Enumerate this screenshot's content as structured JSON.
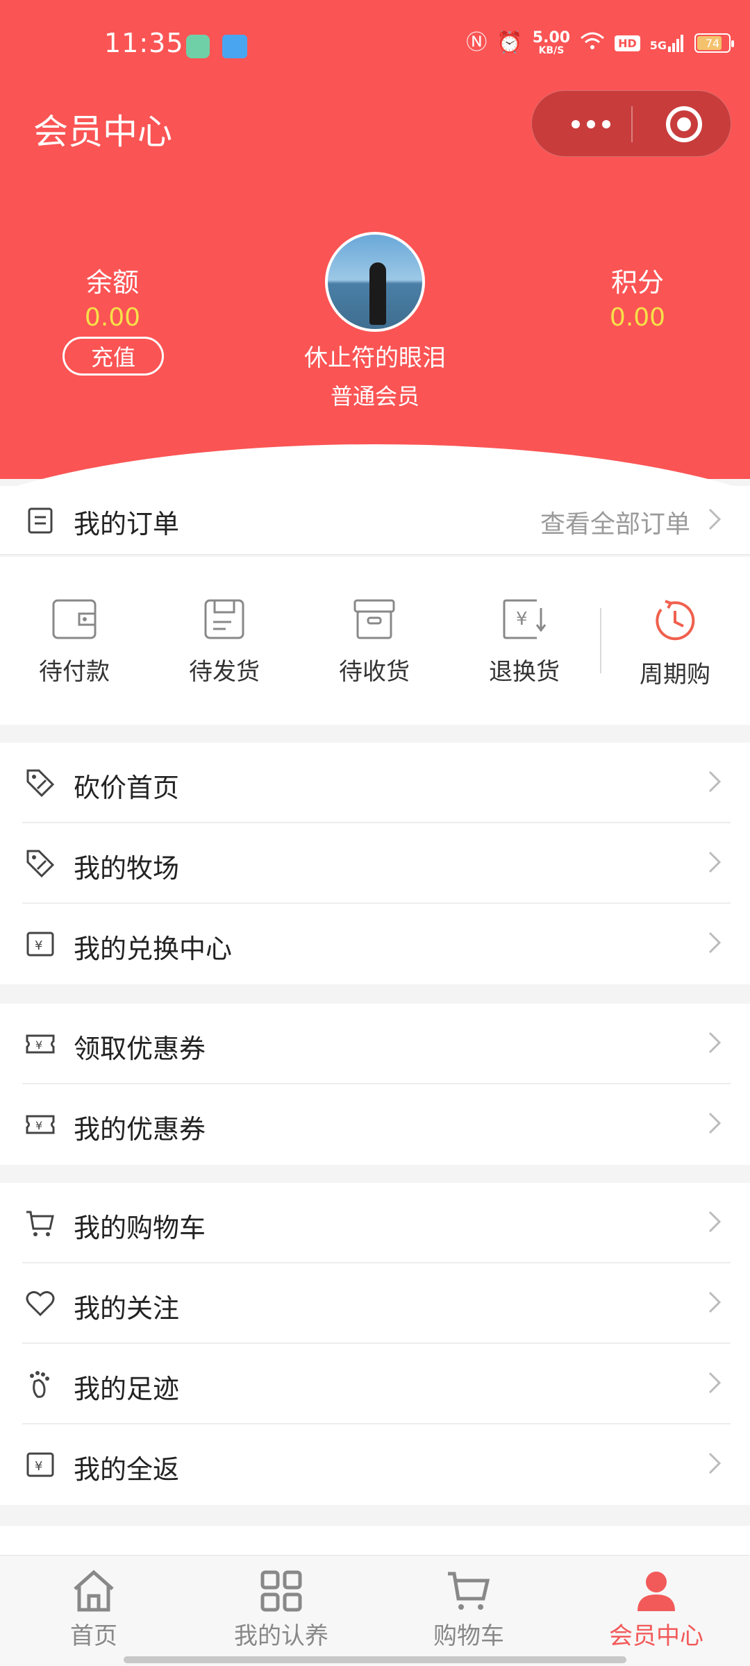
{
  "status_bar": {
    "time": "11:35",
    "network_speed": "5.00",
    "network_speed_unit": "KB/S",
    "hd_label": "HD",
    "signal_label": "5G",
    "battery": "74"
  },
  "header": {
    "title": "会员中心"
  },
  "profile": {
    "balance_label": "余额",
    "balance_value": "0.00",
    "recharge_label": "充值",
    "points_label": "积分",
    "points_value": "0.00",
    "username": "休止符的眼泪",
    "member_level": "普通会员"
  },
  "orders": {
    "title": "我的订单",
    "view_all": "查看全部订单",
    "items": [
      {
        "label": "待付款",
        "icon": "wallet-icon"
      },
      {
        "label": "待发货",
        "icon": "package-icon"
      },
      {
        "label": "待收货",
        "icon": "box-icon"
      },
      {
        "label": "退换货",
        "icon": "refund-icon"
      },
      {
        "label": "周期购",
        "icon": "clock-icon"
      }
    ]
  },
  "menu_groups": [
    {
      "items": [
        {
          "label": "砍价首页",
          "icon": "tag-icon"
        },
        {
          "label": "我的牧场",
          "icon": "tag-icon"
        },
        {
          "label": "我的兑换中心",
          "icon": "exchange-icon"
        }
      ]
    },
    {
      "items": [
        {
          "label": "领取优惠券",
          "icon": "coupon-icon"
        },
        {
          "label": "我的优惠券",
          "icon": "coupon-icon"
        }
      ]
    },
    {
      "items": [
        {
          "label": "我的购物车",
          "icon": "cart-icon"
        },
        {
          "label": "我的关注",
          "icon": "heart-icon"
        },
        {
          "label": "我的足迹",
          "icon": "footprint-icon"
        },
        {
          "label": "我的全返",
          "icon": "exchange-icon"
        }
      ]
    }
  ],
  "tabbar": {
    "items": [
      {
        "label": "首页",
        "icon": "home-icon",
        "active": false
      },
      {
        "label": "我的认养",
        "icon": "grid-icon",
        "active": false
      },
      {
        "label": "购物车",
        "icon": "cart-icon",
        "active": false
      },
      {
        "label": "会员中心",
        "icon": "user-icon",
        "active": true
      }
    ]
  },
  "colors": {
    "brand_red": "#fb5454",
    "value_yellow": "#f6e04a",
    "active_tab": "#f25a5a",
    "cycle_icon": "#f0604d"
  }
}
